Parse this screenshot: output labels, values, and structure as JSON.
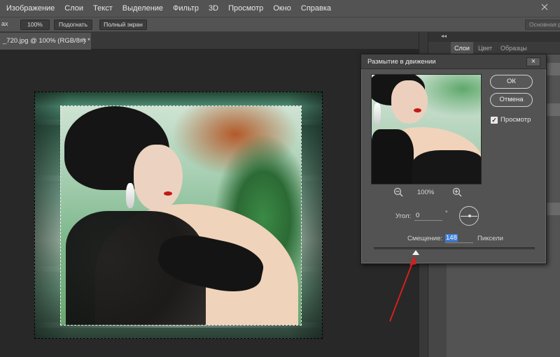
{
  "menu": [
    "Изображение",
    "Слои",
    "Текст",
    "Выделение",
    "Фильтр",
    "3D",
    "Просмотр",
    "Окно",
    "Справка"
  ],
  "options": {
    "left_text": "ах",
    "zoom_button": "100%",
    "fit_button": "Подогнать",
    "fullscreen_button": "Полный экран",
    "workspace": "Основная рабочая"
  },
  "document": {
    "tab_title": "_720.jpg @ 100% (RGB/8#) *",
    "tab_close": "×"
  },
  "panels": {
    "tabs": [
      "Слои",
      "Цвет",
      "Образцы"
    ],
    "active_tab": "Слои",
    "collapse_arrows": "◂◂"
  },
  "dialog": {
    "title": "Размытие в движении",
    "close": "×",
    "ok": "ОК",
    "cancel": "Отмена",
    "preview_label": "Просмотр",
    "preview_checked": true,
    "zoom": "100%",
    "angle_label": "Угол:",
    "angle_value": "0",
    "angle_unit": "°",
    "distance_label": "Смещение:",
    "distance_value": "148",
    "distance_unit": "Пиксели",
    "distance_slider_fraction": 0.26
  },
  "colors": {
    "annotation_arrow": "#d21f1f",
    "selection_highlight": "#3d7ed6"
  }
}
